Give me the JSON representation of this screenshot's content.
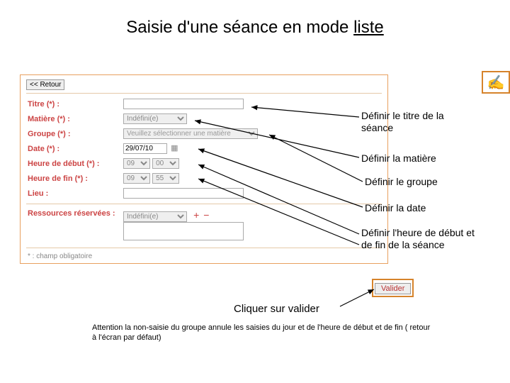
{
  "title": {
    "prefix": "Saisie d'une séance en mode ",
    "underlined": "liste"
  },
  "retour_label": "<< Retour",
  "form": {
    "titre": {
      "label": "Titre (*) :",
      "value": ""
    },
    "matiere": {
      "label": "Matière (*) :",
      "value": "Indéfini(e)"
    },
    "groupe": {
      "label": "Groupe (*) :",
      "placeholder": "Veuillez sélectionner une matière"
    },
    "date": {
      "label": "Date (*) :",
      "value": "29/07/10"
    },
    "heure_debut": {
      "label": "Heure de début (*) :",
      "h": "09",
      "m": "00"
    },
    "heure_fin": {
      "label": "Heure de fin (*) :",
      "h": "09",
      "m": "55"
    },
    "lieu": {
      "label": "Lieu :",
      "value": ""
    },
    "ressources": {
      "label": "Ressources réservées :",
      "value": "Indéfini(e)"
    }
  },
  "required_note": "* : champ obligatoire",
  "annotations": {
    "a1": "Définir le titre de la séance",
    "a2": "Définir la matière",
    "a3": "Définir le groupe",
    "a4": "Définir la date",
    "a5": "Définir l'heure de début et de fin de la séance"
  },
  "valider_label": "Valider",
  "click_valider": "Cliquer sur valider",
  "warning": "Attention la non-saisie du groupe annule les saisies du jour et de l'heure de début et de fin ( retour à l'écran par défaut)"
}
